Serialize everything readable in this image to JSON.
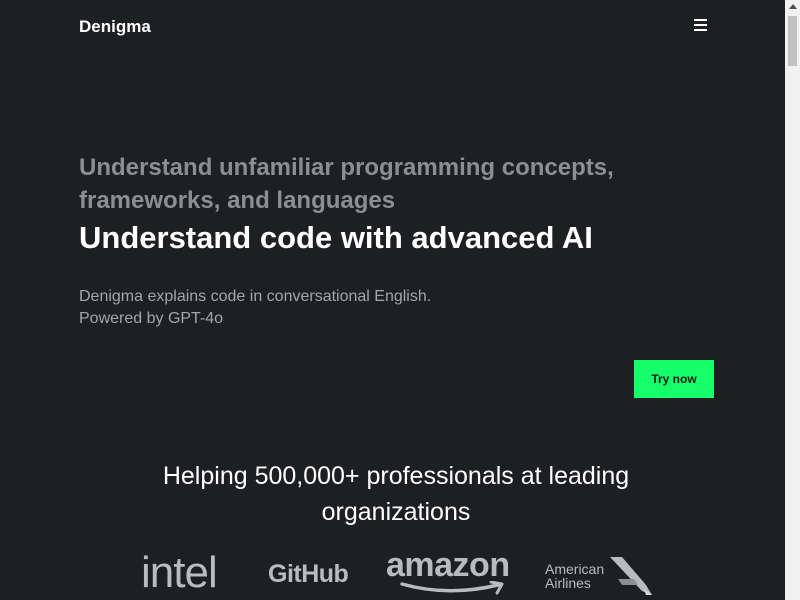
{
  "header": {
    "brand": "Denigma",
    "menu_icon": "hamburger-menu-icon"
  },
  "hero": {
    "subtitle": "Understand unfamiliar programming concepts, frameworks, and languages",
    "title": "Understand code with advanced AI",
    "description_line1": "Denigma explains code in conversational English.",
    "description_line2": "Powered by GPT-4o",
    "cta_label": "Try now"
  },
  "social_proof": {
    "heading": "Helping 500,000+ professionals at leading organizations",
    "logos": {
      "intel": "intel",
      "github": "GitHub",
      "amazon": "amazon",
      "american_airlines_line1": "American",
      "american_airlines_line2": "Airlines"
    }
  },
  "colors": {
    "background": "#1d1f23",
    "accent": "#15ff6a",
    "subtitle_gray": "#8c8e91",
    "logo_gray": "#b9bbbe"
  }
}
